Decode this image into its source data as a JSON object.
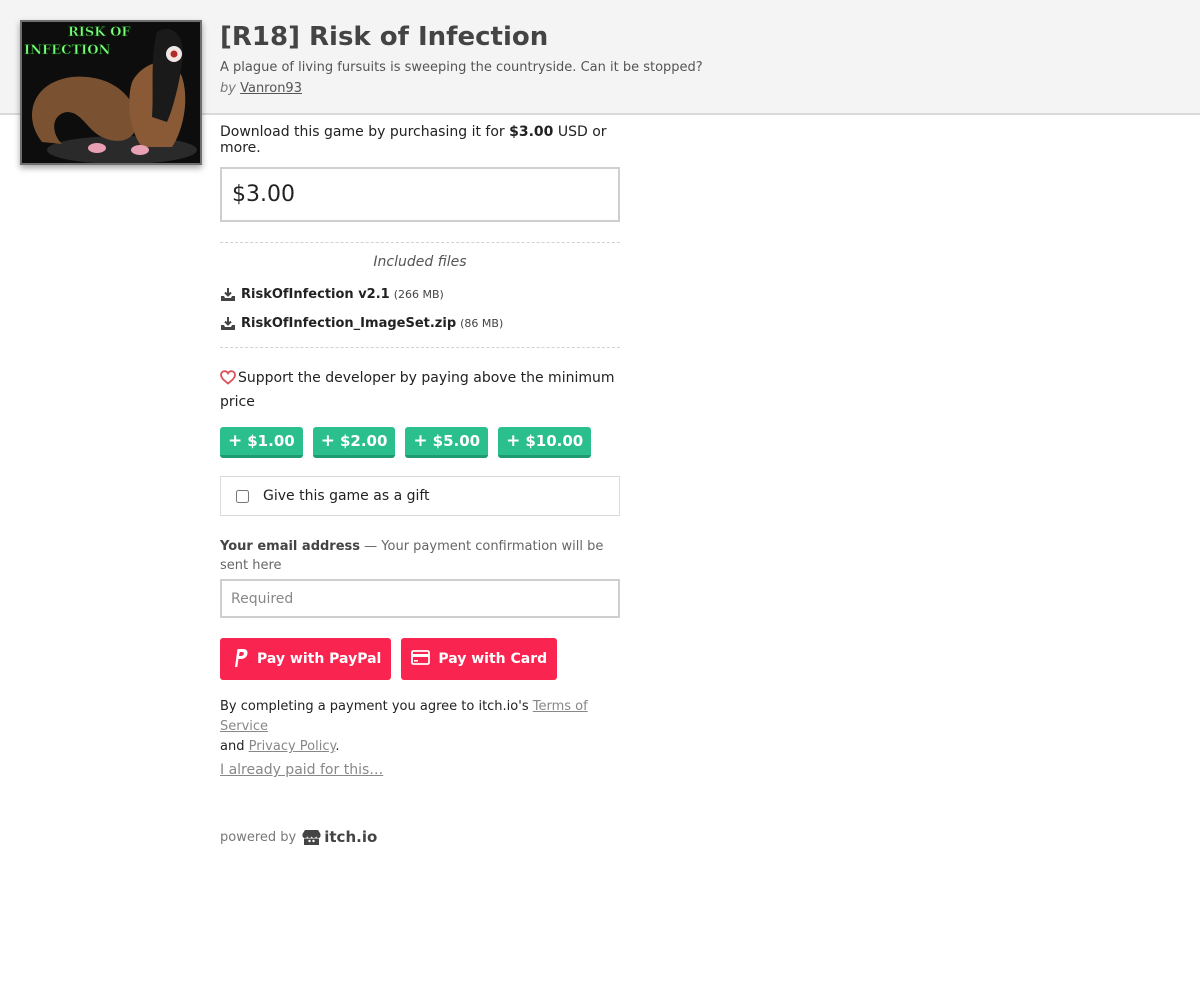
{
  "header": {
    "title": "[R18] Risk of Infection",
    "tagline": "A plague of living fursuits is sweeping the countryside. Can it be stopped?",
    "by_label": "by",
    "author": "Vanron93",
    "cover_text_line1": "RISK OF",
    "cover_text_line2": "INFECTION"
  },
  "purchase": {
    "intro_prefix": "Download this game by purchasing it for",
    "price": "$3.00",
    "intro_suffix": "USD or more.",
    "price_input_value": "$3.00"
  },
  "files": {
    "title": "Included files",
    "items": [
      {
        "name": "RiskOfInfection v2.1",
        "size": "(266 MB)"
      },
      {
        "name": "RiskOfInfection_ImageSet.zip",
        "size": "(86 MB)"
      }
    ]
  },
  "support": {
    "text": "Support the developer by paying above the minimum price",
    "tips": [
      {
        "label": "$1.00"
      },
      {
        "label": "$2.00"
      },
      {
        "label": "$5.00"
      },
      {
        "label": "$10.00"
      }
    ]
  },
  "gift": {
    "label": "Give this game as a gift",
    "checked": false
  },
  "email": {
    "label": "Your email address",
    "hint": "— Your payment confirmation will be sent here",
    "placeholder": "Required"
  },
  "payment": {
    "paypal_label": "Pay with PayPal",
    "card_label": "Pay with Card"
  },
  "legal": {
    "prefix": "By completing a payment you agree to itch.io's",
    "tos": "Terms of Service",
    "and": "and",
    "privacy": "Privacy Policy",
    "period": ".",
    "already_paid": "I already paid for this…"
  },
  "footer": {
    "powered_by": "powered by",
    "brand": "itch.io"
  },
  "colors": {
    "tip_green": "#2bbf8d",
    "pay_red": "#fa2450",
    "header_bg": "#f4f4f4"
  }
}
